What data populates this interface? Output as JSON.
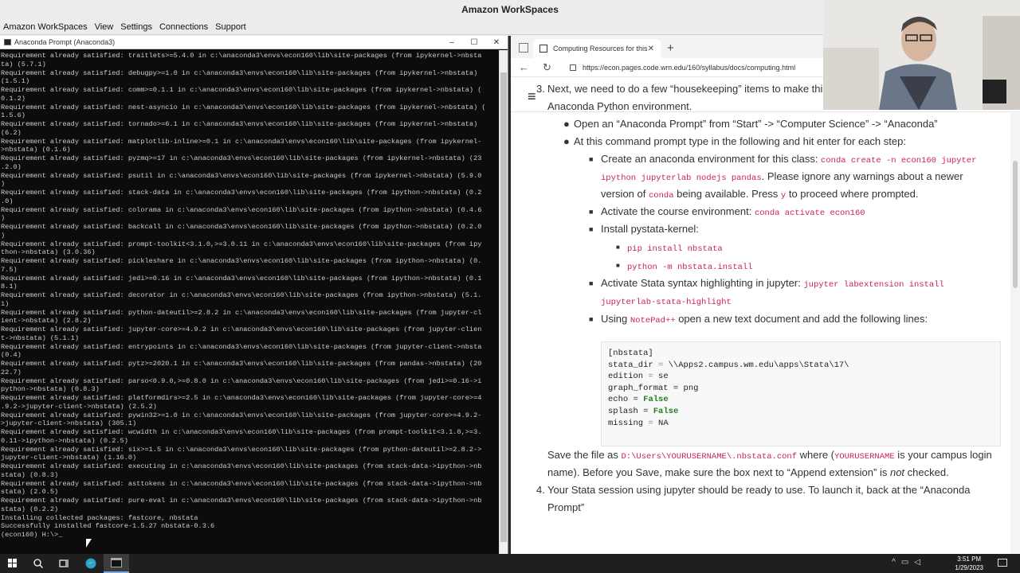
{
  "workspaces": {
    "title": "Amazon WorkSpaces",
    "menu": [
      "Amazon WorkSpaces",
      "View",
      "Settings",
      "Connections",
      "Support"
    ]
  },
  "terminal": {
    "title": "Anaconda Prompt (Anaconda3)",
    "window_controls": [
      "–",
      "☐",
      "✕"
    ],
    "lines": [
      "Requirement already satisfied: traitlets>=5.4.0 in c:\\anaconda3\\envs\\econ160\\lib\\site-packages (from ipykernel->nbsta",
      "ta) (5.7.1)",
      "Requirement already satisfied: debugpy>=1.0 in c:\\anaconda3\\envs\\econ160\\lib\\site-packages (from ipykernel->nbstata)",
      "(1.5.1)",
      "Requirement already satisfied: comm>=0.1.1 in c:\\anaconda3\\envs\\econ160\\lib\\site-packages (from ipykernel->nbstata) (",
      "0.1.2)",
      "Requirement already satisfied: nest-asyncio in c:\\anaconda3\\envs\\econ160\\lib\\site-packages (from ipykernel->nbstata) (",
      "1.5.6)",
      "Requirement already satisfied: tornado>=6.1 in c:\\anaconda3\\envs\\econ160\\lib\\site-packages (from ipykernel->nbstata)",
      "(6.2)",
      "Requirement already satisfied: matplotlib-inline>=0.1 in c:\\anaconda3\\envs\\econ160\\lib\\site-packages (from ipykernel-",
      ">nbstata) (0.1.6)",
      "Requirement already satisfied: pyzmq>=17 in c:\\anaconda3\\envs\\econ160\\lib\\site-packages (from ipykernel->nbstata) (23",
      ".2.0)",
      "Requirement already satisfied: psutil in c:\\anaconda3\\envs\\econ160\\lib\\site-packages (from ipykernel->nbstata) (5.9.0",
      ")",
      "Requirement already satisfied: stack-data in c:\\anaconda3\\envs\\econ160\\lib\\site-packages (from ipython->nbstata) (0.2",
      ".0)",
      "Requirement already satisfied: colorama in c:\\anaconda3\\envs\\econ160\\lib\\site-packages (from ipython->nbstata) (0.4.6",
      ")",
      "Requirement already satisfied: backcall in c:\\anaconda3\\envs\\econ160\\lib\\site-packages (from ipython->nbstata) (0.2.0",
      ")",
      "Requirement already satisfied: prompt-toolkit<3.1.0,>=3.0.11 in c:\\anaconda3\\envs\\econ160\\lib\\site-packages (from ipy",
      "thon->nbstata) (3.0.36)",
      "Requirement already satisfied: pickleshare in c:\\anaconda3\\envs\\econ160\\lib\\site-packages (from ipython->nbstata) (0.",
      "7.5)",
      "Requirement already satisfied: jedi>=0.16 in c:\\anaconda3\\envs\\econ160\\lib\\site-packages (from ipython->nbstata) (0.1",
      "8.1)",
      "Requirement already satisfied: decorator in c:\\anaconda3\\envs\\econ160\\lib\\site-packages (from ipython->nbstata) (5.1.",
      "1)",
      "Requirement already satisfied: python-dateutil>=2.8.2 in c:\\anaconda3\\envs\\econ160\\lib\\site-packages (from jupyter-cl",
      "ient->nbstata) (2.8.2)",
      "Requirement already satisfied: jupyter-core>=4.9.2 in c:\\anaconda3\\envs\\econ160\\lib\\site-packages (from jupyter-clien",
      "t->nbstata) (5.1.1)",
      "Requirement already satisfied: entrypoints in c:\\anaconda3\\envs\\econ160\\lib\\site-packages (from jupyter-client->nbsta",
      "(0.4)",
      "Requirement already satisfied: pytz>=2020.1 in c:\\anaconda3\\envs\\econ160\\lib\\site-packages (from pandas->nbstata) (20",
      "22.7)",
      "Requirement already satisfied: parso<0.9.0,>=0.8.0 in c:\\anaconda3\\envs\\econ160\\lib\\site-packages (from jedi>=0.16->i",
      "python->nbstata) (0.8.3)",
      "Requirement already satisfied: platformdirs>=2.5 in c:\\anaconda3\\envs\\econ160\\lib\\site-packages (from jupyter-core>=4",
      ".9.2->jupyter-client->nbstata) (2.5.2)",
      "Requirement already satisfied: pywin32>=1.0 in c:\\anaconda3\\envs\\econ160\\lib\\site-packages (from jupyter-core>=4.9.2-",
      ">jupyter-client->nbstata) (305.1)",
      "Requirement already satisfied: wcwidth in c:\\anaconda3\\envs\\econ160\\lib\\site-packages (from prompt-toolkit<3.1.0,>=3.",
      "0.11->ipython->nbstata) (0.2.5)",
      "Requirement already satisfied: six>=1.5 in c:\\anaconda3\\envs\\econ160\\lib\\site-packages (from python-dateutil>=2.8.2->",
      "jupyter-client->nbstata) (1.16.0)",
      "Requirement already satisfied: executing in c:\\anaconda3\\envs\\econ160\\lib\\site-packages (from stack-data->ipython->nb",
      "stata) (0.8.3)",
      "Requirement already satisfied: asttokens in c:\\anaconda3\\envs\\econ160\\lib\\site-packages (from stack-data->ipython->nb",
      "stata) (2.0.5)",
      "Requirement already satisfied: pure-eval in c:\\anaconda3\\envs\\econ160\\lib\\site-packages (from stack-data->ipython->nb",
      "stata) (0.2.2)",
      "Installing collected packages: fastcore, nbstata",
      "Successfully installed fastcore-1.5.27 nbstata-0.3.6",
      "",
      "(econ160) H:\\>_"
    ]
  },
  "browser": {
    "tab_title": "Computing Resources for this C...",
    "tab_close": "✕",
    "new_tab": "+",
    "url": "https://econ.pages.code.wm.edu/160/syllabus/docs/computing.html",
    "back": "←",
    "reload": "↻",
    "menu_icon": "≡"
  },
  "doc": {
    "item3_line1": "Next, we need to do a few “housekeeping” items to make things work smoothly in our",
    "item3_line2": "Anaconda Python environment.",
    "sub1": "Open an “Anaconda Prompt” from “Start” -> “Computer Science” -> “Anaconda”",
    "sub2": "At this command prompt type in the following and hit enter for each step:",
    "env_a": "Create an anaconda environment for this class: ",
    "env_code1": "conda create -n econ160 jupyter",
    "env_code2": "ipython jupyterlab nodejs pandas",
    "env_b": ". Please ignore any warnings about a newer",
    "env_c": "version of ",
    "env_conda": "conda",
    "env_d": " being available. Press ",
    "env_y": "y",
    "env_e": " to proceed where prompted.",
    "activate_a": "Activate the course environment: ",
    "activate_code": "conda activate econ160",
    "install_kernel": "Install pystata-kernel:",
    "pip_cmd": "pip install nbstata",
    "py_cmd": "python -m nbstata.install",
    "highlight_a": "Activate Stata syntax highlighting in jupyter: ",
    "highlight_code1": "jupyter labextension install",
    "highlight_code2": "jupyterlab-stata-highlight",
    "notepad_a": "Using ",
    "notepad_code": "NotePad++",
    "notepad_b": " open a new text document and add the following lines:",
    "config": {
      "l1": "[nbstata]",
      "l2a": "stata_dir ",
      "l2b": "=",
      "l2c": " \\\\Apps2.campus.wm.edu\\apps\\Stata\\17\\",
      "l3a": "edition ",
      "l3b": "=",
      "l3c": " se",
      "l4a": "graph_format ",
      "l4b": "=",
      "l4c": " png",
      "l5a": "echo ",
      "l5b": "=",
      "l5c": "False",
      "l6a": "splash ",
      "l6b": "=",
      "l6c": "False",
      "l7a": "missing ",
      "l7b": "=",
      "l7c": " NA"
    },
    "save_a": "Save the file as ",
    "save_code": "D:\\Users\\YOURUSERNAME\\.nbstata.conf",
    "save_b": " where (",
    "save_code2": "YOURUSERNAME",
    "save_c": " is your campus login",
    "save_d": "name). Before you Save, make sure the box next to “Append extension” is ",
    "save_not": "not",
    "save_e": " checked.",
    "item4_line1": "Your Stata session using jupyter should be ready to use. To launch it, back at the “Anaconda",
    "item4_line2": "Prompt”",
    "num3": "3.",
    "num4": "4."
  },
  "taskbar": {
    "time": "3:51 PM",
    "date": "1/29/2023"
  }
}
